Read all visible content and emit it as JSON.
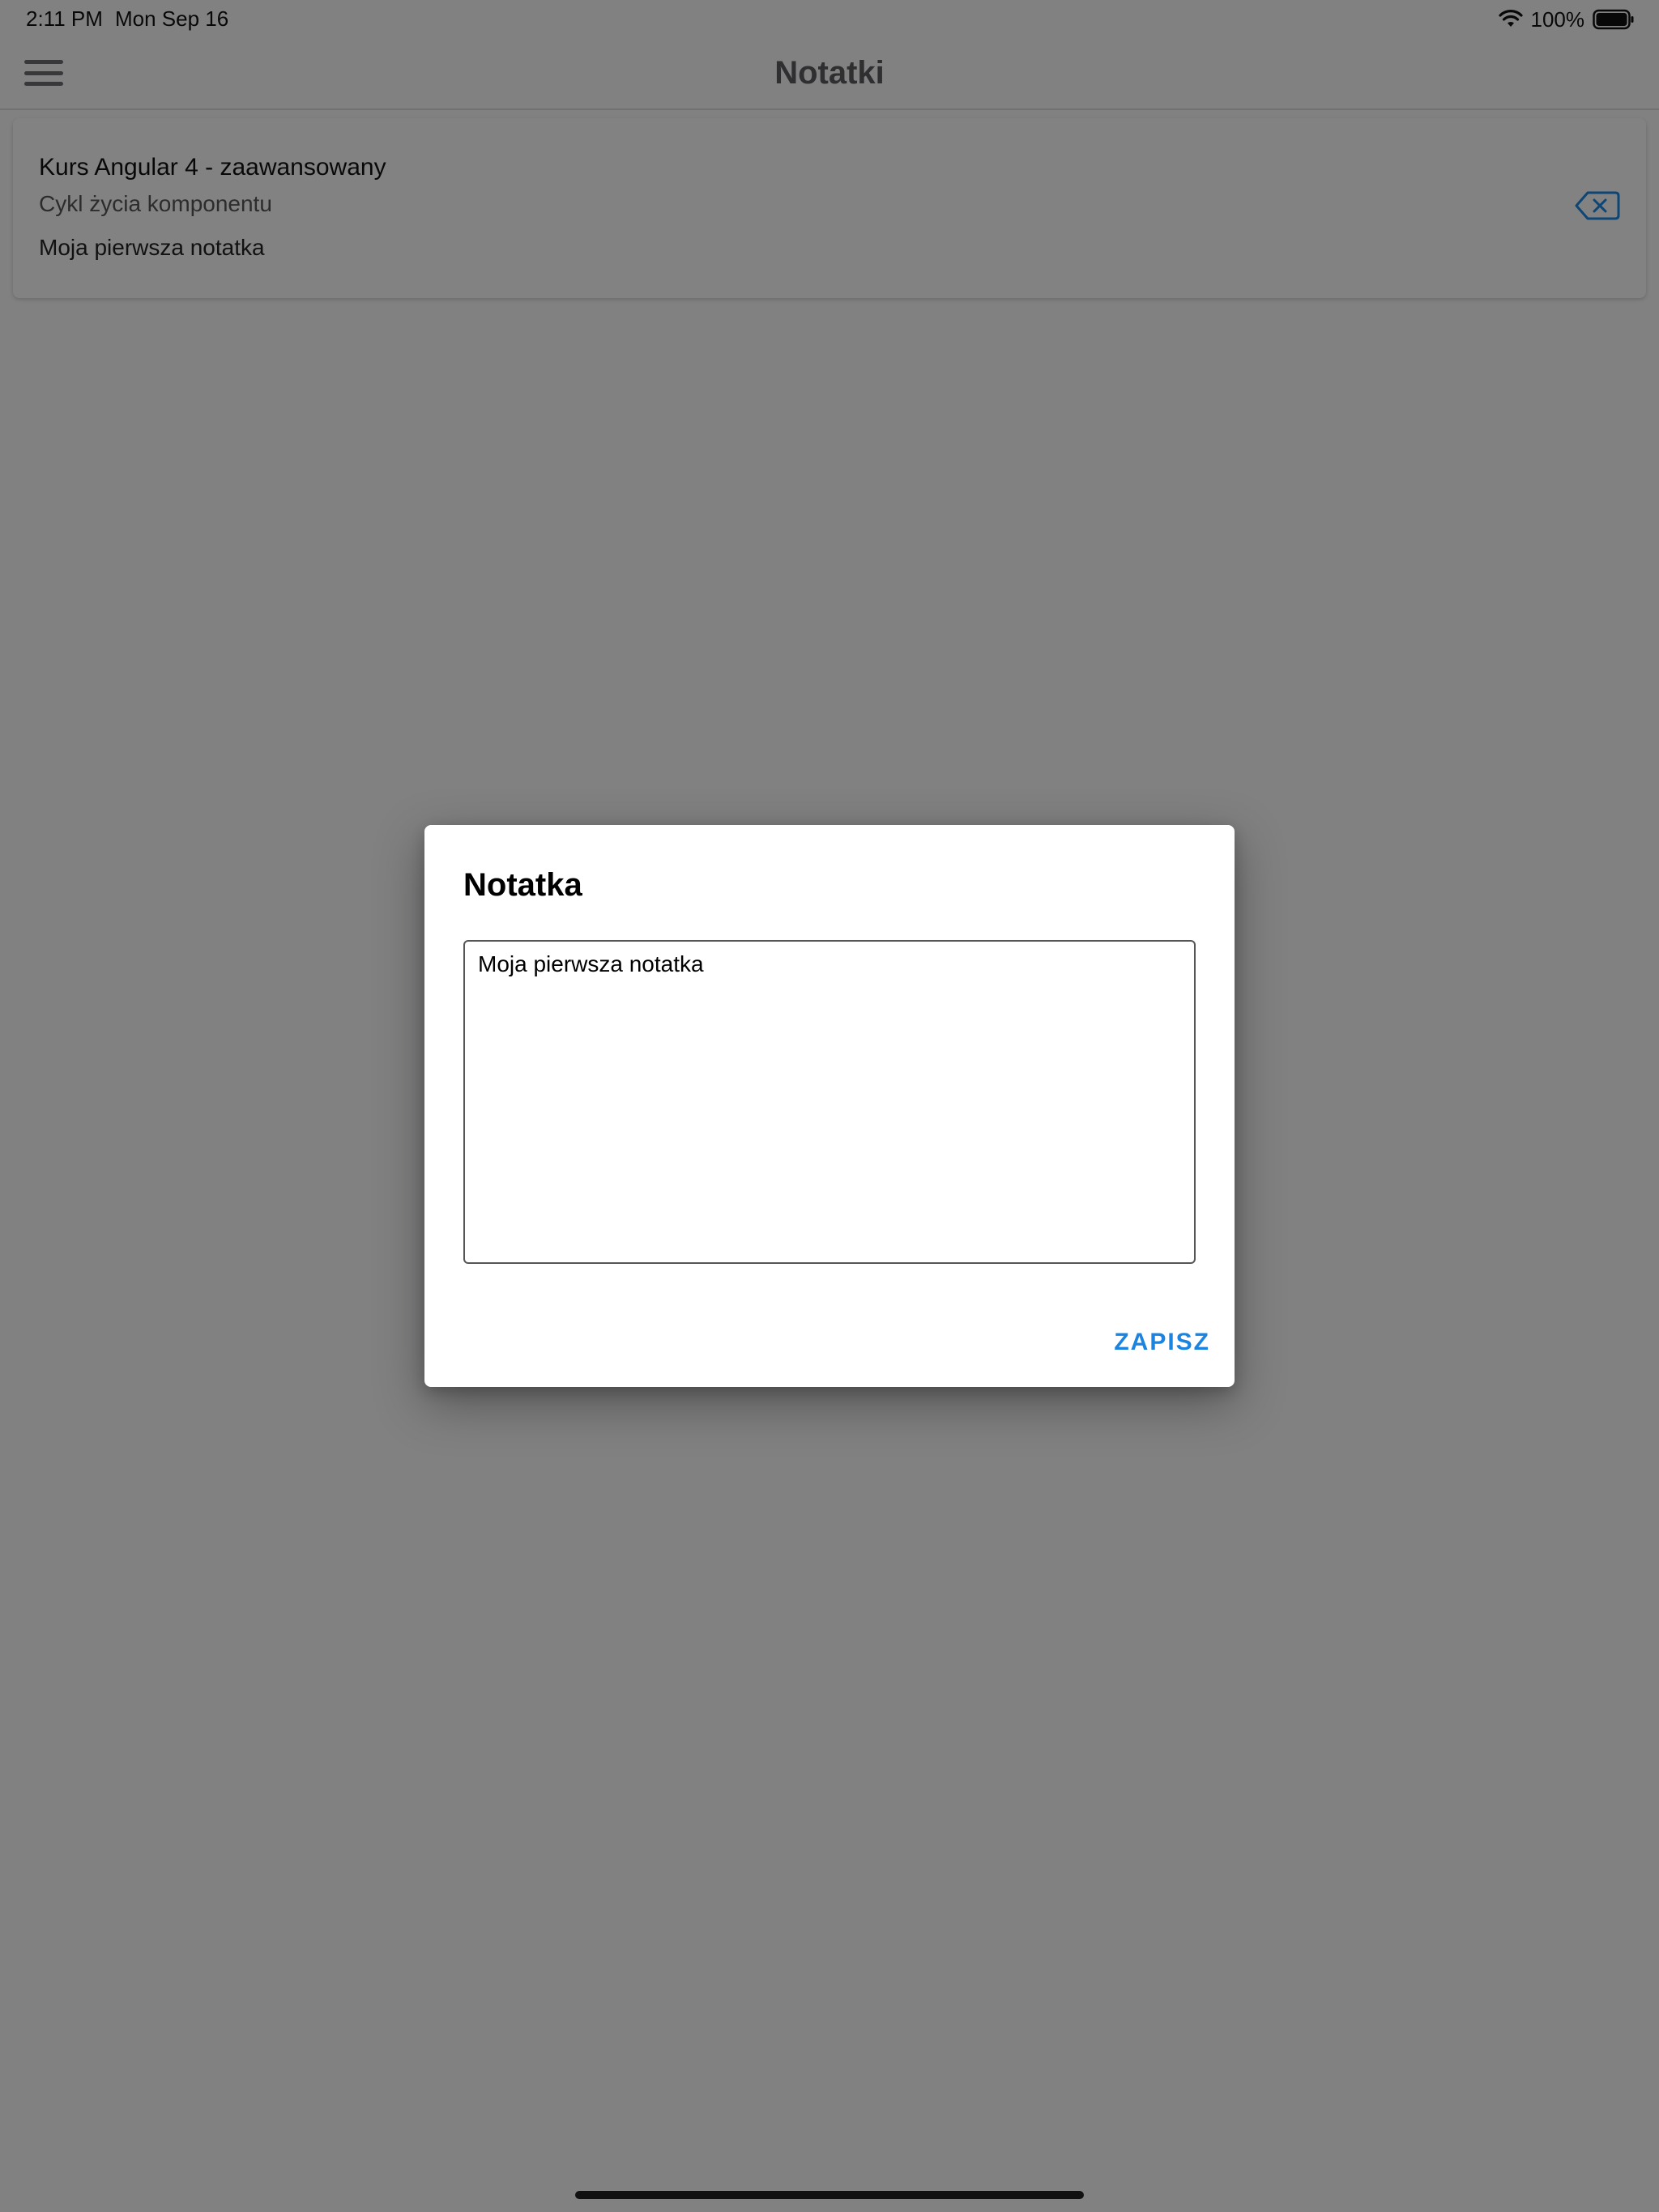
{
  "status_bar": {
    "time": "2:11 PM",
    "date": "Mon Sep 16",
    "battery": "100%",
    "battery_level": 1.0,
    "wifi_icon": "wifi-icon",
    "battery_icon": "battery-icon"
  },
  "header": {
    "title": "Notatki",
    "menu_icon": "hamburger-menu-icon"
  },
  "notes": [
    {
      "course": "Kurs Angular 4 - zaawansowany",
      "lesson": "Cykl życia komponentu",
      "text": "Moja pierwsza notatka",
      "delete_icon": "backspace-delete-icon"
    }
  ],
  "dialog": {
    "title": "Notatka",
    "textarea_value": "Moja pierwsza notatka",
    "save_label": "ZAPISZ"
  },
  "colors": {
    "accent": "#1a84e0",
    "backdrop": "#7f7f81",
    "dialog_bg": "#ffffff"
  }
}
